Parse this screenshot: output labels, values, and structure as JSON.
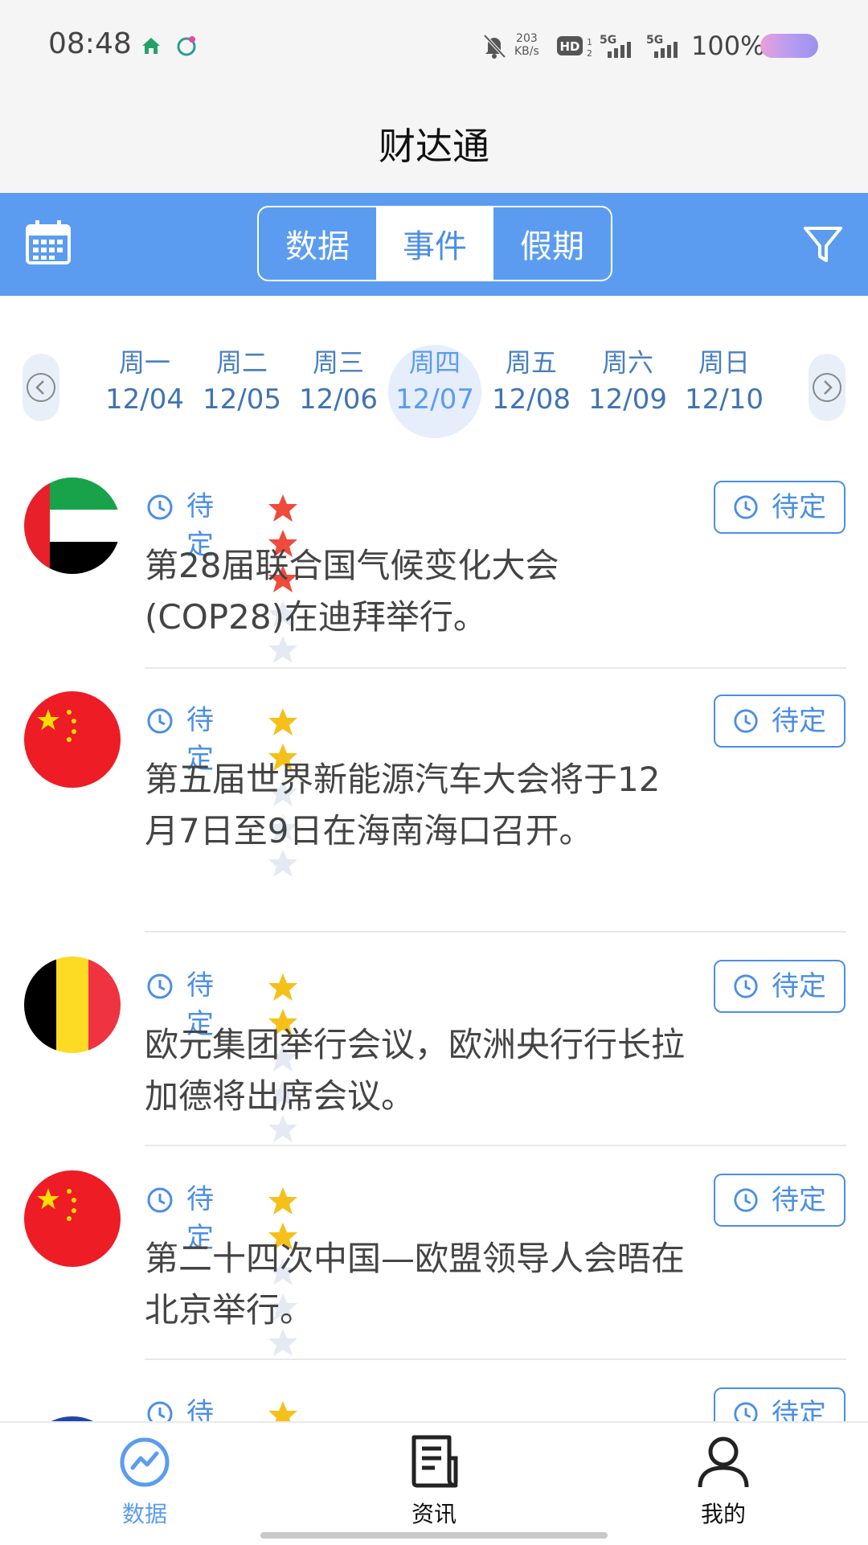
{
  "status_bar": {
    "time": "08:48",
    "net_speed_value": "203",
    "net_speed_unit": "KB/s",
    "hd_label": "HD",
    "signal1_label": "5G",
    "signal2_label": "5G",
    "battery_text": "100%"
  },
  "header": {
    "title": "财达通"
  },
  "toolbar": {
    "tabs": [
      {
        "label": "数据",
        "active": false
      },
      {
        "label": "事件",
        "active": true
      },
      {
        "label": "假期",
        "active": false
      }
    ],
    "colors": {
      "bar": "#5b9cf0",
      "active_text": "#4a8ee6"
    }
  },
  "week": {
    "days": [
      {
        "weekday": "周一",
        "date": "12/04"
      },
      {
        "weekday": "周二",
        "date": "12/05"
      },
      {
        "weekday": "周三",
        "date": "12/06"
      },
      {
        "weekday": "周四",
        "date": "12/07",
        "selected": true
      },
      {
        "weekday": "周五",
        "date": "12/08"
      },
      {
        "weekday": "周六",
        "date": "12/09"
      },
      {
        "weekday": "周日",
        "date": "12/10"
      }
    ]
  },
  "events": [
    {
      "flag": "uae-flag",
      "status": "待定",
      "rating": 3,
      "star_color": "#f04a3c",
      "title": "第28届联合国气候变化大会(COP28)在迪拜举行。",
      "button": "待定"
    },
    {
      "flag": "china-flag",
      "status": "待定",
      "rating": 2,
      "star_color": "#f5c01a",
      "title": "第五届世界新能源汽车大会将于12月7日至9日在海南海口召开。",
      "button": "待定"
    },
    {
      "flag": "belgium-flag",
      "status": "待定",
      "rating": 2,
      "star_color": "#f5c01a",
      "title": "欧元集团举行会议，欧洲央行行长拉加德将出席会议。",
      "button": "待定"
    },
    {
      "flag": "china-flag",
      "status": "待定",
      "rating": 2,
      "star_color": "#f5c01a",
      "title": "第二十四次中国—欧盟领导人会晤在北京举行。",
      "button": "待定"
    },
    {
      "flag": "eu-flag",
      "status": "待定",
      "rating": 2,
      "star_color": "#f5c01a",
      "title": "",
      "button": "待定"
    }
  ],
  "bottom_nav": [
    {
      "label": "数据",
      "icon": "chart-line-icon",
      "active": true
    },
    {
      "label": "资讯",
      "icon": "document-icon",
      "active": false
    },
    {
      "label": "我的",
      "icon": "user-icon",
      "active": false
    }
  ]
}
